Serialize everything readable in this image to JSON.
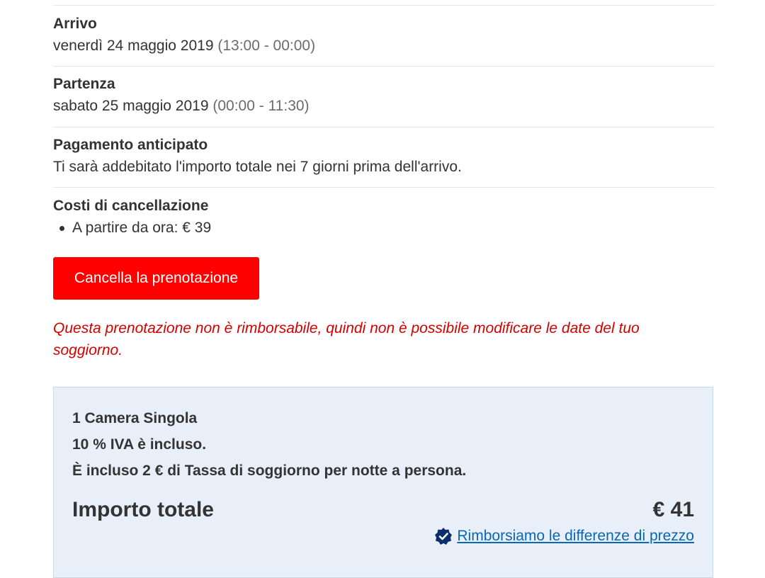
{
  "arrival": {
    "label": "Arrivo",
    "date": "venerdì 24 maggio 2019",
    "time": "(13:00 - 00:00)"
  },
  "departure": {
    "label": "Partenza",
    "date": "sabato 25 maggio 2019",
    "time": "(00:00 - 11:30)"
  },
  "prepayment": {
    "label": "Pagamento anticipato",
    "text": "Ti sarà addebitato l'importo totale nei 7 giorni prima dell'arrivo."
  },
  "cancellation_costs": {
    "label": "Costi di cancellazione",
    "items": [
      "A partire da ora: € 39"
    ]
  },
  "cancel_button": {
    "label": "Cancella la prenotazione"
  },
  "warning": "Questa prenotazione non è rimborsabile, quindi non è possibile modificare le date del tuo soggiorno.",
  "summary": {
    "room": "1 Camera Singola",
    "vat": "10 % IVA è incluso.",
    "tax": "È incluso 2 € di Tassa di soggiorno per notte a persona.",
    "total_label": "Importo totale",
    "total_value": "€ 41",
    "refund_link": "Rimborsiamo le differenze di prezzo"
  },
  "colors": {
    "cancel_button": "#ff0000",
    "warning_text": "#d40000",
    "summary_bg": "#e8eff9",
    "link": "#0a67b3"
  },
  "icons": {
    "refund_badge": "verified-badge-icon"
  }
}
